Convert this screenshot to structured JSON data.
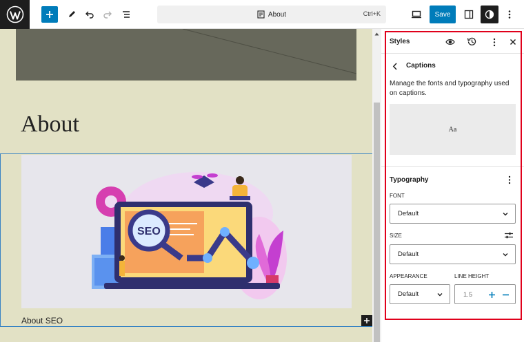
{
  "toolbar": {
    "document_title": "About",
    "shortcut": "Ctrl+K",
    "save_label": "Save"
  },
  "canvas": {
    "page_title": "About",
    "image_caption": "About SEO",
    "illustration_text": "SEO"
  },
  "styles_panel": {
    "header": "Styles",
    "nav_title": "Captions",
    "description": "Manage the fonts and typography used on captions.",
    "preview_text": "Aa",
    "typography": {
      "title": "Typography",
      "font_label": "FONT",
      "font_value": "Default",
      "size_label": "SIZE",
      "size_value": "Default",
      "appearance_label": "APPEARANCE",
      "appearance_value": "Default",
      "line_height_label": "LINE HEIGHT",
      "line_height_placeholder": "1.5"
    }
  },
  "colors": {
    "accent": "#007cba",
    "canvas_bg": "#e2e1c5",
    "highlight": "#e0001b"
  },
  "icons": [
    "wordpress-logo",
    "plus-icon",
    "pen-icon",
    "undo-icon",
    "redo-icon",
    "list-view-icon",
    "page-icon",
    "desktop-icon",
    "sidebar-icon",
    "half-circle-icon",
    "more-vertical-icon",
    "eye-icon",
    "revisions-icon",
    "close-icon",
    "chevron-left-icon",
    "chevron-down-icon",
    "sliders-icon",
    "minus-icon"
  ]
}
